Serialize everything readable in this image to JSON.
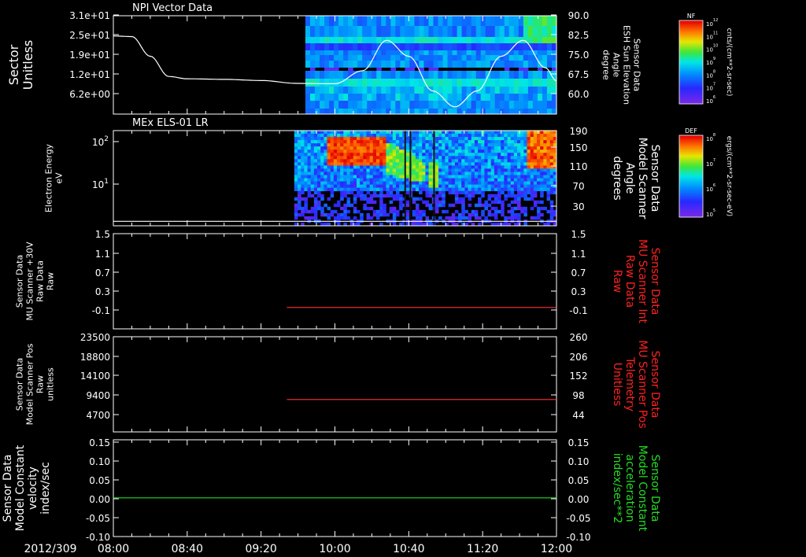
{
  "date_label": "2012/309",
  "time_ticks": [
    "08:00",
    "08:40",
    "09:20",
    "10:00",
    "10:40",
    "11:20",
    "12:00"
  ],
  "chart_data": [
    {
      "type": "heatmap",
      "title": "NPI Vector Data",
      "ylabel_left": [
        "Sector",
        "Unitless"
      ],
      "yticks_left": [
        "3.1e+01",
        "2.5e+01",
        "1.9e+01",
        "1.2e+01",
        "6.2e+00"
      ],
      "ylabel_right": [
        "Sensor Data",
        "ESH Sun Elevation",
        "Angle",
        "degree"
      ],
      "yticks_right": [
        "90.0",
        "82.5",
        "75.0",
        "67.5",
        "60.0"
      ],
      "ylim_right": [
        56,
        90
      ],
      "data_start": "09:44",
      "line_series": {
        "color": "#ffffff",
        "x": [
          "08:00",
          "08:10",
          "08:20",
          "08:30",
          "08:40",
          "09:00",
          "09:20",
          "09:40",
          "10:00",
          "10:15",
          "10:28",
          "10:40",
          "10:53",
          "11:05",
          "11:17",
          "11:30",
          "11:42",
          "11:54",
          "12:00"
        ],
        "y": [
          83.0,
          82.8,
          76.0,
          69.0,
          68.2,
          68.0,
          67.6,
          66.6,
          66.5,
          71.0,
          81.5,
          76.0,
          64.0,
          58.5,
          64.0,
          76.0,
          81.5,
          72.0,
          67.5
        ]
      },
      "colorbar": {
        "label": "NF",
        "units": "cnts/(cm**2-sr-sec)",
        "ticks": [
          "10^12",
          "10^11",
          "10^10",
          "10^9",
          "10^8",
          "10^7",
          "10^6"
        ]
      }
    },
    {
      "type": "heatmap",
      "title": "MEx ELS-01 LR",
      "ylabel_left": [
        "Electron Energy",
        "eV"
      ],
      "yticks_left": [
        "10^2",
        "10^1"
      ],
      "ylabel_right": [
        "Sensor Data",
        "Model Scanner",
        "Angle",
        "degrees"
      ],
      "yticks_right": [
        "190",
        "150",
        "110",
        "70",
        "30"
      ],
      "ylim_right": [
        0,
        190
      ],
      "data_start": "09:38",
      "line_series": {
        "color": "#ffffff",
        "x": [
          "08:00",
          "12:00"
        ],
        "y": [
          9,
          9
        ]
      },
      "colorbar": {
        "label": "DEF",
        "units": "ergs/(cm**2-sr-sec-eV)",
        "ticks": [
          "10^8",
          "10^7",
          "10^6",
          "10^5"
        ]
      }
    },
    {
      "type": "line",
      "ylabel_left": [
        "Sensor Data",
        "MU Scanner +30V",
        "Raw Data",
        "Raw"
      ],
      "yticks_left": [
        "1.5",
        "1.1",
        "0.7",
        "0.3",
        "-0.1"
      ],
      "ylabel_right": [
        "Sensor Data",
        "MU Scanner Int",
        "Raw Data",
        "Raw"
      ],
      "yticks_right": [
        "1.5",
        "1.1",
        "0.7",
        "0.3",
        "-0.1"
      ],
      "ylim": [
        -0.5,
        1.5
      ],
      "series": [
        {
          "color": "#ff3333",
          "x": [
            "09:34",
            "12:00"
          ],
          "y": [
            -0.05,
            -0.05
          ]
        }
      ]
    },
    {
      "type": "line",
      "ylabel_left": [
        "Sensor Data",
        "Model Scanner Pos",
        "Raw",
        "unitless"
      ],
      "yticks_left": [
        "23500",
        "18800",
        "14100",
        "9400",
        "4700"
      ],
      "ylabel_right": [
        "Sensor Data",
        "MU Scanner Pos",
        "Telemetry",
        "Unitless"
      ],
      "yticks_right": [
        "260",
        "206",
        "152",
        "98",
        "44"
      ],
      "ylim": [
        0,
        23500
      ],
      "series": [
        {
          "color": "#ff3333",
          "x": [
            "09:34",
            "12:00"
          ],
          "y": [
            8000,
            8000
          ]
        }
      ]
    },
    {
      "type": "line",
      "ylabel_left": [
        "Sensor Data",
        "Model Constant",
        "velocity",
        "index/sec"
      ],
      "yticks_left": [
        "0.15",
        "0.10",
        "0.05",
        "0.00",
        "-0.05",
        "-0.10"
      ],
      "ylabel_right": [
        "Sensor Data",
        "Model Constant",
        "acceleration",
        "index/sec**2"
      ],
      "yticks_right": [
        "0.15",
        "0.10",
        "0.05",
        "0.00",
        "-0.05",
        "-0.10"
      ],
      "ylim": [
        -0.1,
        0.15
      ],
      "series": [
        {
          "color": "#22dd22",
          "x": [
            "08:00",
            "12:00"
          ],
          "y": [
            0,
            0
          ]
        }
      ]
    }
  ],
  "colors": {
    "panel_border": "#ffffff",
    "red_label": "#ff2020",
    "green_label": "#22dd22"
  }
}
